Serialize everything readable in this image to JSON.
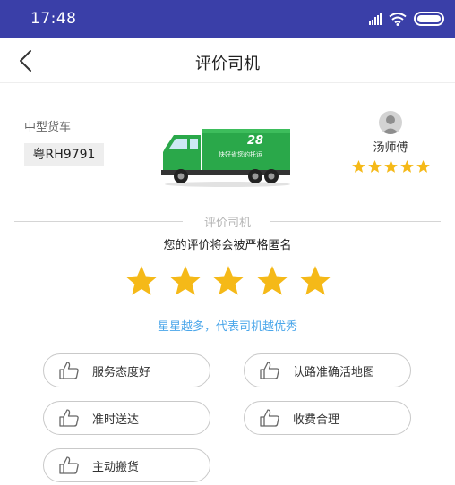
{
  "status_bar": {
    "time": "17:48"
  },
  "header": {
    "title": "评价司机"
  },
  "vehicle": {
    "type": "中型货车",
    "plate": "粤RH9791",
    "truck_logo": "28",
    "truck_slogan": "快好省您的托运"
  },
  "driver": {
    "name": "汤师傅",
    "rating": 5
  },
  "rating": {
    "section_title": "评价司机",
    "anonymous_note": "您的评价将会被严格匿名",
    "stars_selected": 5,
    "stars_total": 5,
    "hint": "星星越多，代表司机越优秀"
  },
  "tags": [
    "服务态度好",
    "认路准确活地图",
    "准时送达",
    "收费合理",
    "主动搬货"
  ],
  "colors": {
    "status_bar": "#3a3fa8",
    "star": "#f5b918",
    "hint": "#4aa6ea",
    "truck_green": "#2aa84a"
  }
}
